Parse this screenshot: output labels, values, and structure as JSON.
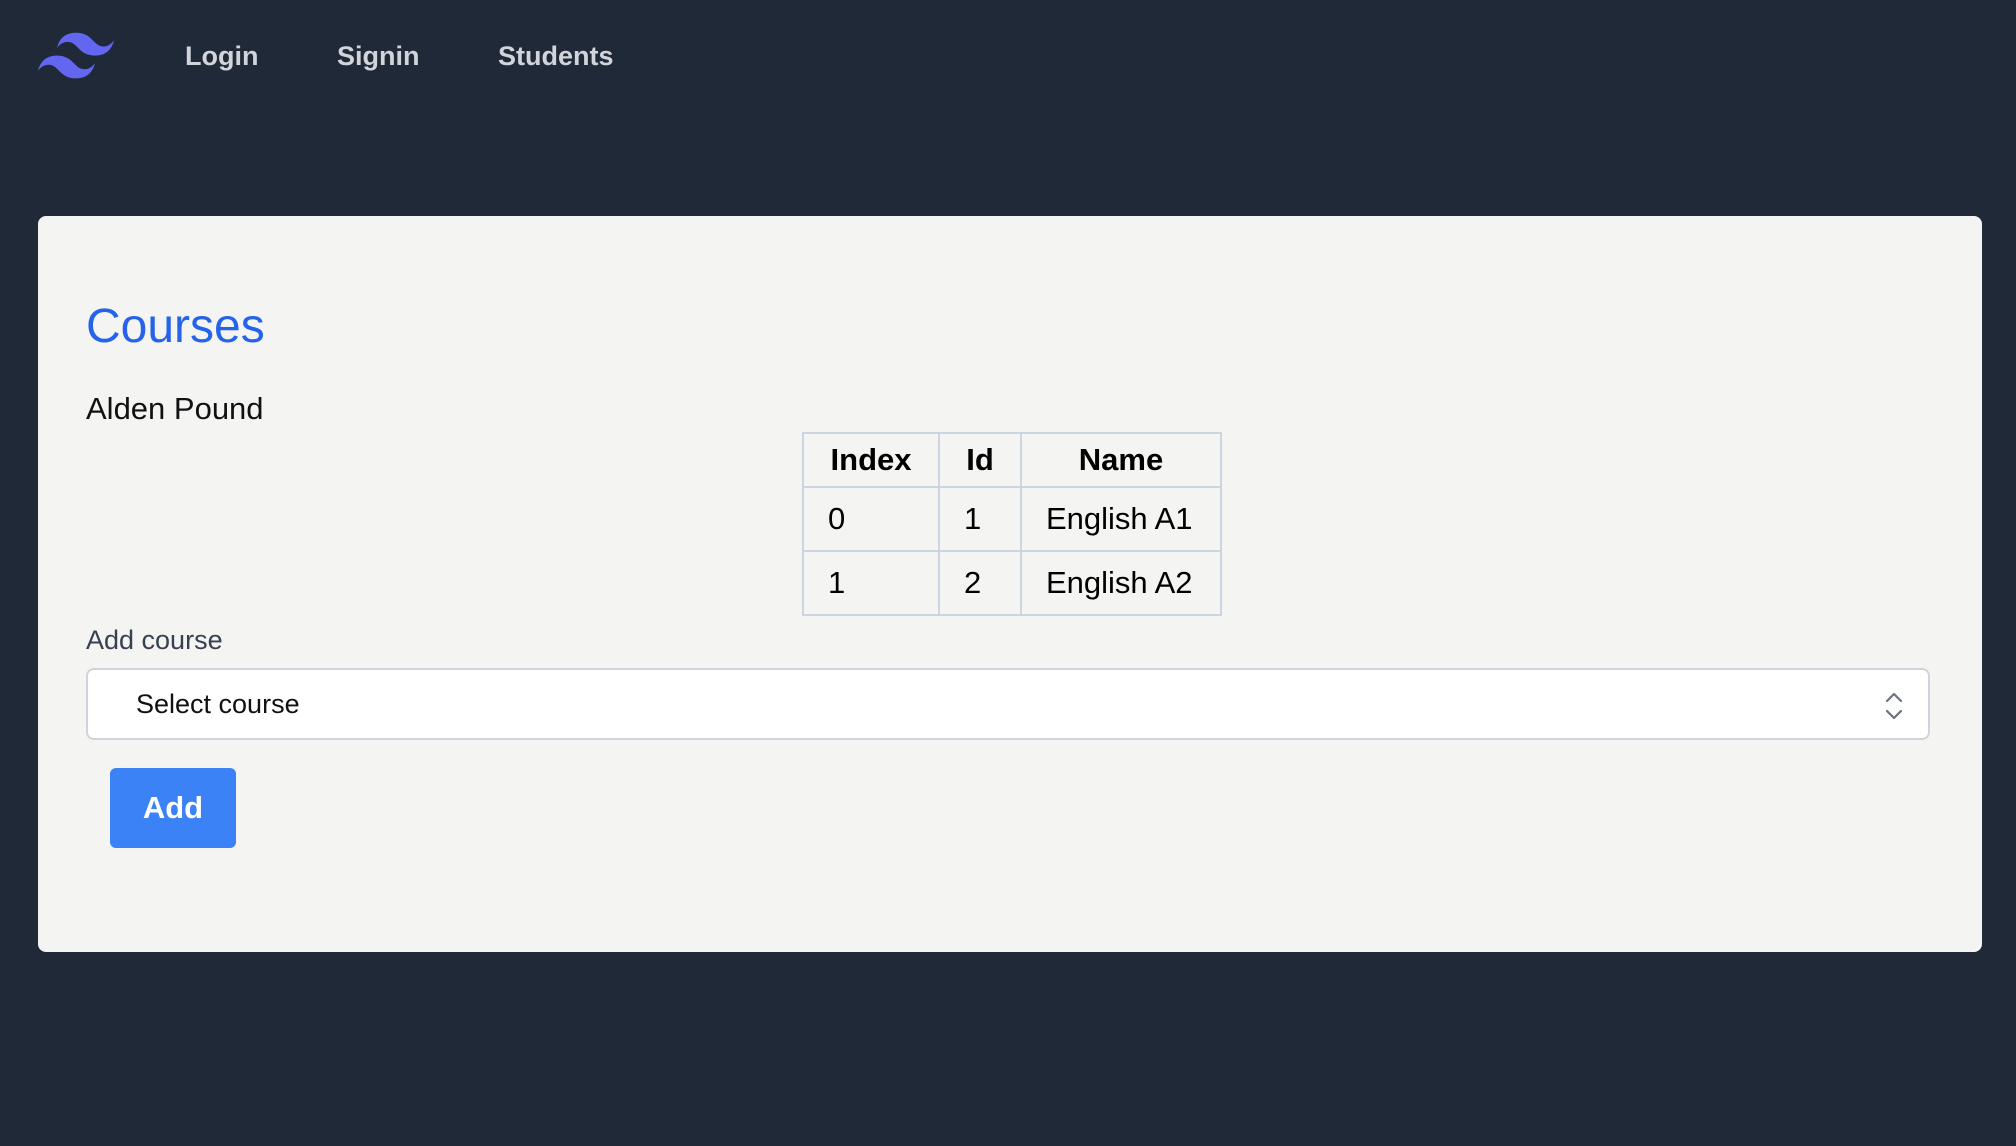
{
  "nav": {
    "logo_icon": "tailwind-logo-icon",
    "links": [
      {
        "label": "Login"
      },
      {
        "label": "Signin"
      },
      {
        "label": "Students"
      }
    ]
  },
  "main": {
    "title": "Courses",
    "student_name": "Alden Pound",
    "table": {
      "headers": [
        "Index",
        "Id",
        "Name"
      ],
      "rows": [
        {
          "index": "0",
          "id": "1",
          "name": "English A1"
        },
        {
          "index": "1",
          "id": "2",
          "name": "English A2"
        }
      ]
    },
    "add_course": {
      "label": "Add course",
      "select_value": "Select course",
      "select_icon": "chevron-up-down-icon",
      "button_label": "Add"
    }
  },
  "colors": {
    "background": "#1f2937",
    "card": "#f4f4f2",
    "title": "#2563eb",
    "button": "#3b82f6",
    "logo": "#6366f1"
  }
}
